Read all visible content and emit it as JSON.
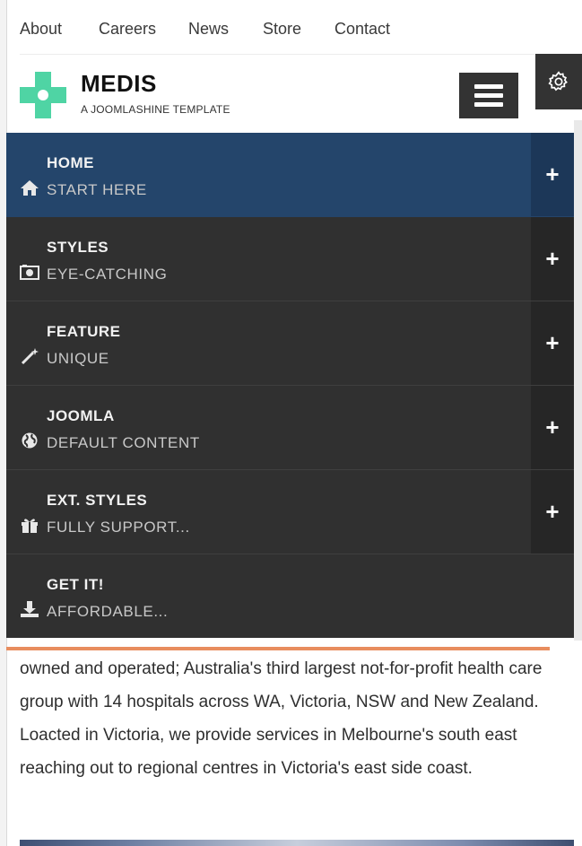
{
  "top_nav": [
    "About",
    "Careers",
    "News",
    "Store",
    "Contact"
  ],
  "brand": {
    "name": "MEDIS",
    "tagline": "A JOOMLASHINE TEMPLATE"
  },
  "menu": [
    {
      "title": "HOME",
      "subtitle": "START HERE",
      "icon": "home-icon",
      "active": true,
      "expandable": true
    },
    {
      "title": "STYLES",
      "subtitle": "EYE-CATCHING",
      "icon": "camera-icon",
      "active": false,
      "expandable": true
    },
    {
      "title": "FEATURE",
      "subtitle": "UNIQUE",
      "icon": "magic-wand-icon",
      "active": false,
      "expandable": true
    },
    {
      "title": "JOOMLA",
      "subtitle": "DEFAULT CONTENT",
      "icon": "globe-icon",
      "active": false,
      "expandable": true
    },
    {
      "title": "EXT. STYLES",
      "subtitle": "FULLY SUPPORT...",
      "icon": "gift-icon",
      "active": false,
      "expandable": true
    },
    {
      "title": "GET IT!",
      "subtitle": "AFFORDABLE...",
      "icon": "download-icon",
      "active": false,
      "expandable": false
    }
  ],
  "expand_symbol": "+",
  "content_text": "owned and operated; Australia's third largest not-for-profit health care group with 14 hospitals across WA, Victoria, NSW and New Zealand. Loacted in Victoria, we provide services in Melbourne's south east reaching out to regional centres in Victoria's east side coast.",
  "colors": {
    "accent_logo": "#4fd4a4",
    "menu_active": "#24456b",
    "menu_bg": "#303030",
    "divider": "#e88d5e"
  }
}
